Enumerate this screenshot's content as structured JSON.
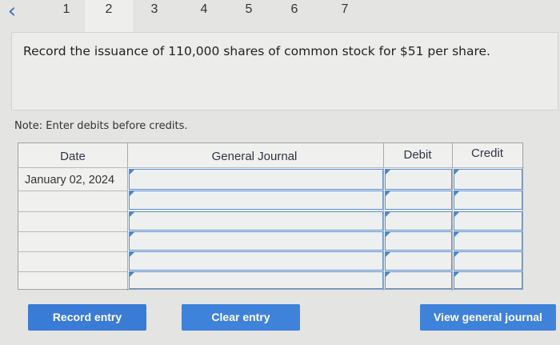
{
  "steps": [
    "1",
    "2",
    "3",
    "4",
    "5",
    "6",
    "7"
  ],
  "question": "Record the issuance of 110,000 shares of common stock for $51 per share.",
  "note": "Note: Enter debits before credits.",
  "table": {
    "headers": {
      "date": "Date",
      "journal": "General Journal",
      "debit": "Debit",
      "credit": "Credit"
    },
    "first_date": "January 02, 2024"
  },
  "buttons": {
    "record": "Record entry",
    "clear": "Clear entry",
    "view": "View general journal"
  }
}
